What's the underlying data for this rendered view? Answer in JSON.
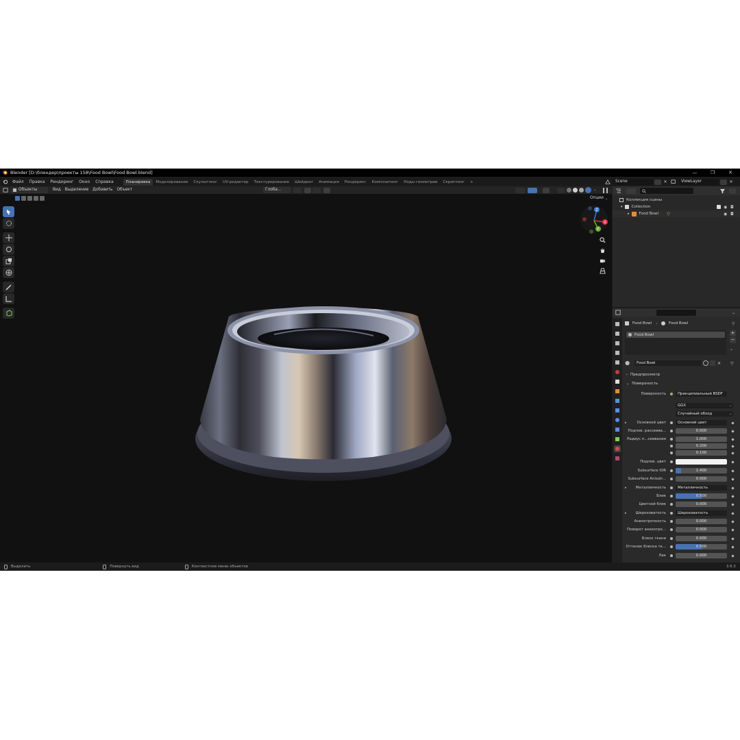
{
  "window": {
    "title": "Blender [D:\\блендер\\проекты 158\\Food Bowl\\Food Bowl.blend]"
  },
  "menu": [
    "Файл",
    "Правка",
    "Рендеринг",
    "Окно",
    "Справка"
  ],
  "workspaces": [
    "Планировка",
    "Моделирование",
    "Скульптинг",
    "UV-редактор",
    "Текстурирование",
    "Шейдинг",
    "Анимация",
    "Рендеринг",
    "Композитинг",
    "Ноды геометрии",
    "Скриптинг"
  ],
  "workspace_add": "+",
  "scene": {
    "name": "Scene",
    "view_layer": "ViewLayer"
  },
  "viewport": {
    "mode": "Объекты",
    "menus": [
      "Вид",
      "Выделение",
      "Добавить",
      "Объект"
    ],
    "transform_orientation": "Глоба...",
    "options_label": "Опции"
  },
  "gizmo": {
    "x": "X",
    "y": "Y",
    "z": "Z"
  },
  "outliner": {
    "root": "Коллекция сцены",
    "collection": "Collection",
    "object": "Food Bowl"
  },
  "properties": {
    "breadcrumb_object": "Food Bowl",
    "breadcrumb_material": "Food Bowl",
    "slot_name": "Food Bowl",
    "material_name": "Food Bowl",
    "preview_label": "Предпросмотр",
    "surface_label": "Поверхность",
    "surface_row": {
      "label": "Поверхность",
      "value": "Принципиальный BSDF"
    },
    "distribution": "GGX",
    "subsurface_method": "Случайный обход",
    "rows": [
      {
        "label": "Основной цвет",
        "value": "Основной цвет",
        "link": true
      },
      {
        "label": "Подпов. рассеива...",
        "value": "0.000"
      },
      {
        "label": "Радиус п...сеивания",
        "value": "1.000"
      },
      {
        "label": "",
        "value": "0.200"
      },
      {
        "label": "",
        "value": "0.100"
      },
      {
        "label": "Подпов. цвет",
        "value": "",
        "swatch": "#f2f2f2"
      },
      {
        "label": "Subsurface IOR",
        "value": "1.400",
        "fill": 0.1
      },
      {
        "label": "Subsurface Anisotr...",
        "value": "0.000"
      },
      {
        "label": "Металличность",
        "value": "Металличность",
        "link": true
      },
      {
        "label": "Блик",
        "value": "0.500",
        "fill": 0.5
      },
      {
        "label": "Цветной блик",
        "value": "0.000"
      },
      {
        "label": "Шероховатость",
        "value": "Шероховатость",
        "link": true
      },
      {
        "label": "Анизотропность",
        "value": "0.000"
      },
      {
        "label": "Поворот анизотро...",
        "value": "0.000"
      },
      {
        "label": "Блеск ткани",
        "value": "0.000"
      },
      {
        "label": "Оттенок блеска тк...",
        "value": "0.500",
        "fill": 0.5
      },
      {
        "label": "Лак",
        "value": "0.000"
      }
    ]
  },
  "status": {
    "select": "Выделить",
    "rotate": "Повернуть вид",
    "context": "Контекстное меню объектов",
    "version": "3.6.3"
  },
  "colors": {
    "accent": "#4772b3",
    "gizmo_x": "#e0334a",
    "gizmo_y": "#72b032",
    "gizmo_z": "#3a79d8"
  }
}
